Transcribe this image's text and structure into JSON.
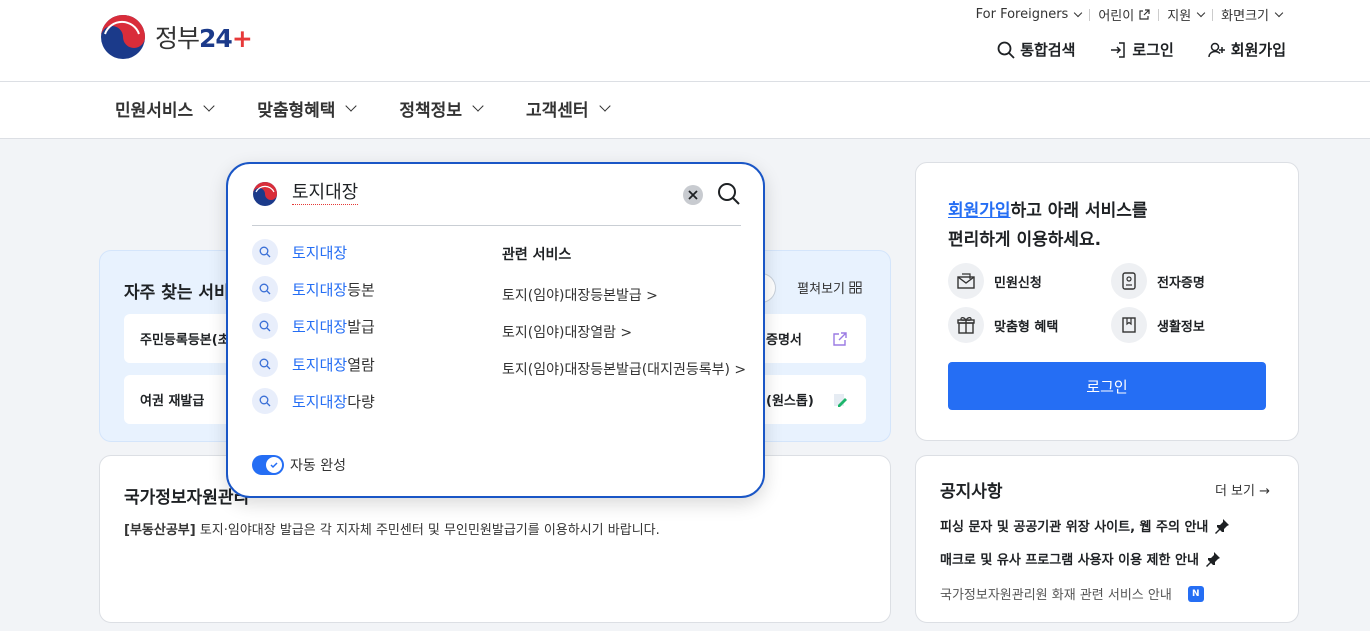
{
  "header": {
    "logo_text": "정부",
    "logo_num": "24",
    "logo_plus": "+",
    "util": [
      {
        "label": "For Foreigners"
      },
      {
        "label": "어린이"
      },
      {
        "label": "지원"
      },
      {
        "label": "화면크기"
      }
    ],
    "actions": {
      "search": "통합검색",
      "login": "로그인",
      "signup": "회원가입"
    }
  },
  "gnb": {
    "items": [
      "민원서비스",
      "맞춤형혜택",
      "정책정보",
      "고객센터"
    ]
  },
  "frequent": {
    "title": "자주 찾는 서비",
    "expand": "펼쳐보기",
    "cards": [
      "주민등록등본(초",
      "여권 재발급",
      "증명서",
      "(원스톱)"
    ]
  },
  "notice_wide": {
    "title": "국가정보자원관리",
    "tag": "[부동산공부]",
    "text": " 토지·임야대장 발급은 각 지자체 주민센터 및 무인민원발급기를 이용하시기 바랍니다."
  },
  "login_panel": {
    "title_link": "회원가입",
    "title_rest": "하고 아래 서비스를",
    "title_line2": "편리하게 이용하세요.",
    "items": [
      "민원신청",
      "전자증명",
      "맞춤형 혜택",
      "생활정보"
    ],
    "button": "로그인"
  },
  "notice_panel": {
    "title": "공지사항",
    "more": "더 보기 →",
    "items": [
      "피싱 문자 및 공공기관 위장 사이트, 웹 주의 안내",
      "매크로 및 유사 프로그램 사용자 이용 제한 안내",
      "국가정보자원관리원 화재 관련 서비스 안내"
    ],
    "new_badge": "N"
  },
  "search_popup": {
    "query": "토지대장",
    "suggestions": [
      {
        "hl": "토지대장",
        "rest": ""
      },
      {
        "hl": "토지대장",
        "rest": "등본"
      },
      {
        "hl": "토지대장",
        "rest": "발급"
      },
      {
        "hl": "토지대장",
        "rest": "열람"
      },
      {
        "hl": "토지대장",
        "rest": "다량"
      }
    ],
    "related_title": "관련 서비스",
    "related": [
      "토지(임야)대장등본발급 >",
      "토지(임야)대장열람 >",
      "토지(임야)대장등본발급(대지권등록부) >"
    ],
    "autocomplete_label": "자동 완성"
  },
  "colors": {
    "accent": "#256ef4",
    "popup_border": "#1a56c6",
    "light_panel": "#e8f2fe"
  }
}
